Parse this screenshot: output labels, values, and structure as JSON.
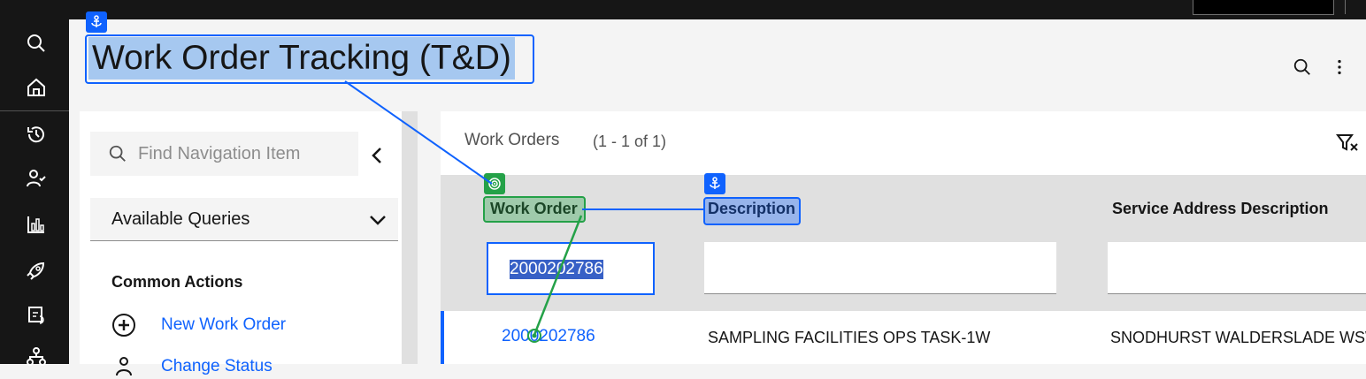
{
  "app": {
    "title": "Work Order Tracking (T&D)"
  },
  "left_nav": {
    "icons": [
      "search-icon",
      "home-icon",
      "history-icon",
      "user-check-icon",
      "chart-icon",
      "rocket-icon",
      "calendar-sync-icon",
      "org-chart-icon"
    ]
  },
  "header": {
    "actions": [
      "search-icon",
      "overflow-menu-icon"
    ]
  },
  "side_panel": {
    "search_placeholder": "Find Navigation Item",
    "queries_label": "Available Queries",
    "common_actions_title": "Common Actions",
    "actions": [
      {
        "label": "New Work Order",
        "icon": "add-circle-icon"
      },
      {
        "label": "Change Status",
        "icon": "person-icon"
      }
    ]
  },
  "table": {
    "title": "Work Orders",
    "count": "(1 - 1 of 1)",
    "columns": [
      "Work Order",
      "Description",
      "Service Address Description"
    ],
    "filters": [
      "2000202786",
      "",
      ""
    ],
    "rows": [
      {
        "work_order": "2000202786",
        "description": "SAMPLING FACILITIES OPS TASK-1W",
        "service_address": "SNODHURST WALDERSLADE WSW"
      }
    ]
  },
  "colors": {
    "accent": "#0f62fe",
    "annotation_green": "#24a148",
    "nav_bg": "#161616"
  }
}
